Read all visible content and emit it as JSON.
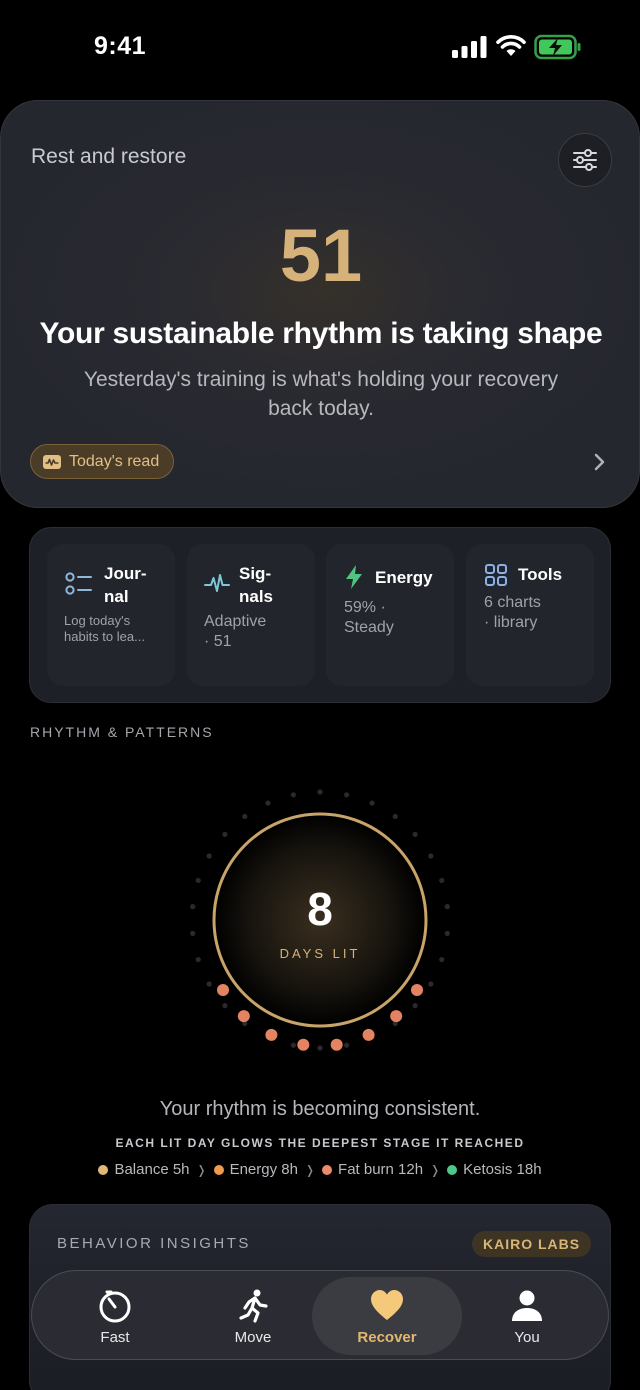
{
  "status": {
    "time": "9:41"
  },
  "hero": {
    "title": "Rest and restore",
    "score": "51",
    "headline": "Your sustainable rhythm is taking shape",
    "subtitle": "Yesterday's training is what's holding your recovery back today.",
    "pill_label": "Today's read",
    "accent": "#d6b27a"
  },
  "tiles": [
    {
      "name_line1": "Jour-",
      "name_line2": "nal",
      "sub": "Log today's habits to lea...",
      "icon": "checklist-icon"
    },
    {
      "name_line1": "Sig-",
      "name_line2": "nals",
      "sub_line1": "Adaptive",
      "sub_line2": "· 51",
      "icon": "pulse-icon"
    },
    {
      "name": "Energy",
      "sub_line1": "59% ·",
      "sub_line2": "Steady",
      "icon": "lightning-icon"
    },
    {
      "name": "Tools",
      "sub_line1": "6 charts",
      "sub_line2": "· library",
      "icon": "grid-icon"
    }
  ],
  "rhythm": {
    "section_label": "RHYTHM & PATTERNS",
    "days_value": "8",
    "days_label": "DAYS LIT",
    "message": "Your rhythm is becoming consistent.",
    "note": "EACH LIT DAY GLOWS THE DEEPEST STAGE IT REACHED",
    "legend": [
      {
        "label": "Balance 5h",
        "color": "#e2b877"
      },
      {
        "label": "Energy 8h",
        "color": "#ef9a4e"
      },
      {
        "label": "Fat burn 12h",
        "color": "#ec8a6b"
      },
      {
        "label": "Ketosis 18h",
        "color": "#4cc88a"
      }
    ]
  },
  "insights": {
    "label": "BEHAVIOR INSIGHTS",
    "badge": "KAIRO LABS"
  },
  "tabbar": {
    "tabs": [
      {
        "label": "Fast",
        "icon": "timer-icon"
      },
      {
        "label": "Move",
        "icon": "running-icon"
      },
      {
        "label": "Recover",
        "icon": "heart-icon",
        "active": true
      },
      {
        "label": "You",
        "icon": "person-icon"
      }
    ]
  }
}
